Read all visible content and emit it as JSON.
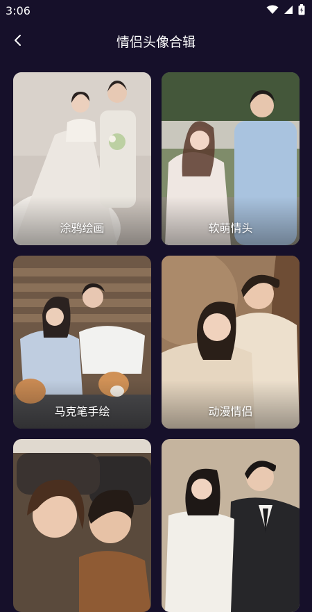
{
  "status": {
    "time": "3:06"
  },
  "header": {
    "title": "情侣头像合辑"
  },
  "cards": [
    {
      "label": "涂鸦绘画"
    },
    {
      "label": "软萌情头"
    },
    {
      "label": "马克笔手绘"
    },
    {
      "label": "动漫情侣"
    },
    {
      "label": ""
    },
    {
      "label": ""
    }
  ],
  "colors": {
    "background": "#16102a",
    "text": "#ffffff"
  }
}
